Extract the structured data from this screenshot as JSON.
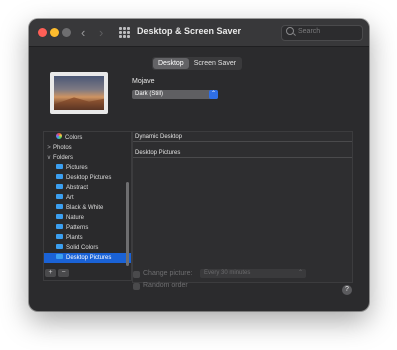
{
  "window": {
    "title": "Desktop & Screen Saver",
    "back_icon": "‹",
    "forward_icon": "›"
  },
  "search": {
    "placeholder": "Search"
  },
  "tabs": [
    {
      "label": "Desktop",
      "active": true
    },
    {
      "label": "Screen Saver",
      "active": false
    }
  ],
  "wallpaper": {
    "name": "Mojave",
    "mode": "Dark (Still)",
    "mode_arrow": "⌃"
  },
  "sidebar": {
    "items": [
      {
        "label": "Colors",
        "icon": "colors-icon"
      },
      {
        "label": "Photos",
        "disclosure": ">"
      },
      {
        "label": "Folders",
        "disclosure": "∨"
      },
      {
        "label": "Pictures",
        "icon": "folder-icon"
      },
      {
        "label": "Desktop Pictures",
        "icon": "folder-icon"
      },
      {
        "label": "Abstract",
        "icon": "folder-icon"
      },
      {
        "label": "Art",
        "icon": "folder-icon"
      },
      {
        "label": "Black & White",
        "icon": "folder-icon"
      },
      {
        "label": "Nature",
        "icon": "folder-icon"
      },
      {
        "label": "Patterns",
        "icon": "folder-icon"
      },
      {
        "label": "Plants",
        "icon": "folder-icon"
      },
      {
        "label": "Solid Colors",
        "icon": "folder-icon"
      },
      {
        "label": "Desktop Pictures",
        "icon": "folder-icon",
        "selected": true
      }
    ],
    "add_label": "+",
    "remove_label": "−"
  },
  "main": {
    "groups": [
      "Dynamic Desktop",
      "Desktop Pictures"
    ]
  },
  "options": {
    "change_picture_label": "Change picture:",
    "interval_value": "Every 30 minutes",
    "interval_arrow": "⌃",
    "random_order_label": "Random order",
    "help_label": "?"
  },
  "colors": {
    "accent": "#1a62d6",
    "window_bg": "#2b2b2d"
  }
}
